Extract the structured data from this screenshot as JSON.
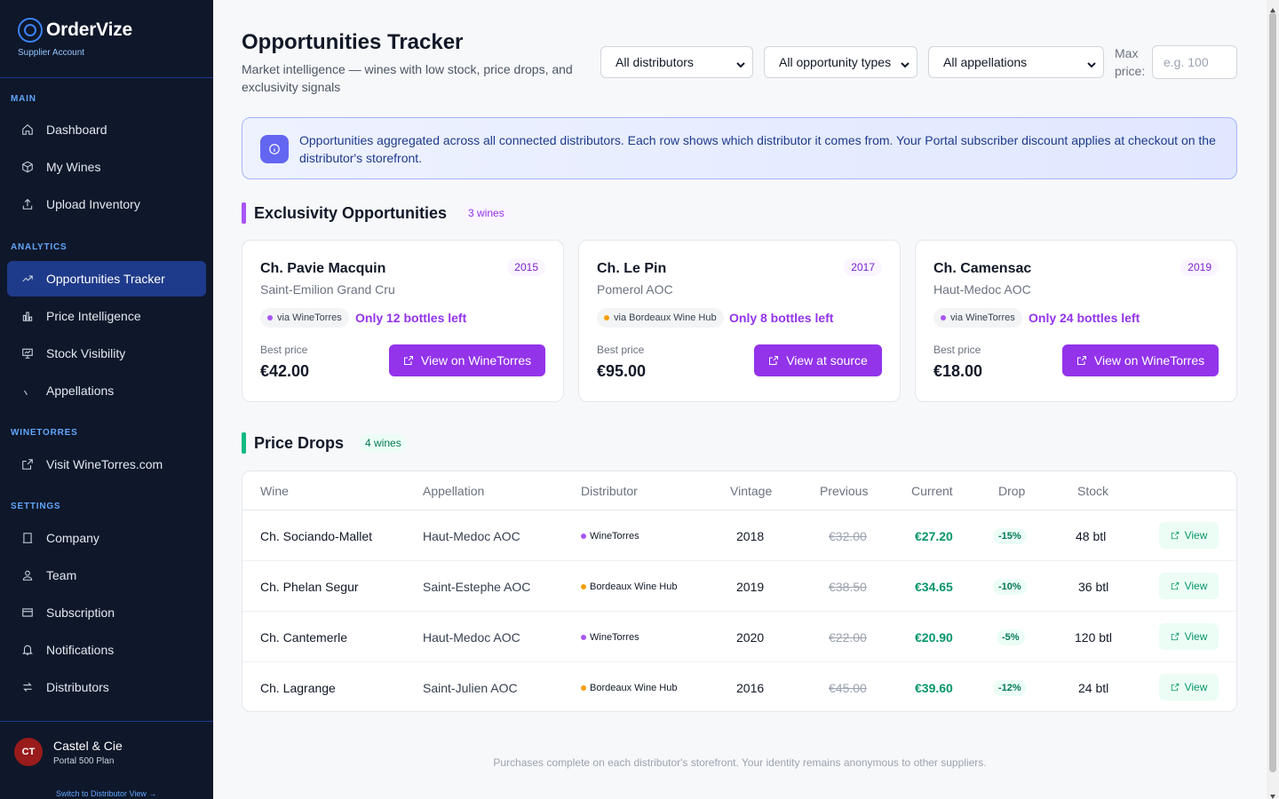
{
  "brand": {
    "name": "OrderVize",
    "subtitle": "Supplier Account"
  },
  "sidebar": {
    "sections": {
      "main": "MAIN",
      "analytics": "ANALYTICS",
      "winetorres": "WINETORRES",
      "settings": "SETTINGS"
    },
    "items": [
      {
        "label": "Dashboard",
        "icon": "home-icon"
      },
      {
        "label": "My Wines",
        "icon": "box-icon"
      },
      {
        "label": "Upload Inventory",
        "icon": "upload-icon"
      },
      {
        "label": "Opportunities Tracker",
        "icon": "trending-up-icon",
        "active": true
      },
      {
        "label": "Price Intelligence",
        "icon": "bar-chart-icon"
      },
      {
        "label": "Stock Visibility",
        "icon": "monitor-icon"
      },
      {
        "label": "Appellations",
        "icon": "map-pin-icon"
      },
      {
        "label": "Visit WineTorres.com",
        "icon": "external-link-icon"
      },
      {
        "label": "Company",
        "icon": "building-icon"
      },
      {
        "label": "Team",
        "icon": "users-icon"
      },
      {
        "label": "Subscription",
        "icon": "credit-card-icon"
      },
      {
        "label": "Notifications",
        "icon": "bell-icon"
      },
      {
        "label": "Distributors",
        "icon": "swap-icon"
      }
    ],
    "user": {
      "initials": "CT",
      "name": "Castel & Cie",
      "plan": "Portal 500 Plan",
      "switch_label": "Switch to Distributor View →"
    }
  },
  "header": {
    "title": "Opportunities Tracker",
    "description": "Market intelligence — wines with low stock, price drops, and exclusivity signals"
  },
  "filters": {
    "distributor": "All distributors",
    "type": "All opportunity types",
    "appellation": "All appellations",
    "max_price_label": "Max price:",
    "max_price_placeholder": "e.g. 100"
  },
  "info": {
    "text": "Opportunities aggregated across all connected distributors. Each row shows which distributor it comes from. Your Portal subscriber discount applies at checkout on the distributor's storefront."
  },
  "exclusivity": {
    "title": "Exclusivity Opportunities",
    "count": "3 wines",
    "accent": "#a855f7",
    "cards": [
      {
        "name": "Ch. Pavie Macquin",
        "vintage": "2015",
        "appellation": "Saint-Emilion Grand Cru",
        "via": "via WineTorres",
        "via_color": "#a855f7",
        "stock": "Only 12 bottles left",
        "best_label": "Best price",
        "price": "€42.00",
        "button": "View on WineTorres"
      },
      {
        "name": "Ch. Le Pin",
        "vintage": "2017",
        "appellation": "Pomerol AOC",
        "via": "via Bordeaux Wine Hub",
        "via_color": "#f59e0b",
        "stock": "Only 8 bottles left",
        "best_label": "Best price",
        "price": "€95.00",
        "button": "View at source"
      },
      {
        "name": "Ch. Camensac",
        "vintage": "2019",
        "appellation": "Haut-Medoc AOC",
        "via": "via WineTorres",
        "via_color": "#a855f7",
        "stock": "Only 24 bottles left",
        "best_label": "Best price",
        "price": "€18.00",
        "button": "View on WineTorres"
      }
    ]
  },
  "price_drops": {
    "title": "Price Drops",
    "count": "4 wines",
    "accent": "#10b981",
    "columns": [
      "Wine",
      "Appellation",
      "Distributor",
      "Vintage",
      "Previous",
      "Current",
      "Drop",
      "Stock"
    ],
    "rows": [
      {
        "wine": "Ch. Sociando-Mallet",
        "appellation": "Haut-Medoc AOC",
        "distributor": "WineTorres",
        "dist_color": "#a855f7",
        "vintage": "2018",
        "previous": "€32.00",
        "current": "€27.20",
        "drop": "-15%",
        "stock": "48 btl",
        "action": "View"
      },
      {
        "wine": "Ch. Phelan Segur",
        "appellation": "Saint-Estephe AOC",
        "distributor": "Bordeaux Wine Hub",
        "dist_color": "#f59e0b",
        "vintage": "2019",
        "previous": "€38.50",
        "current": "€34.65",
        "drop": "-10%",
        "stock": "36 btl",
        "action": "View"
      },
      {
        "wine": "Ch. Cantemerle",
        "appellation": "Haut-Medoc AOC",
        "distributor": "WineTorres",
        "dist_color": "#a855f7",
        "vintage": "2020",
        "previous": "€22.00",
        "current": "€20.90",
        "drop": "-5%",
        "stock": "120 btl",
        "action": "View"
      },
      {
        "wine": "Ch. Lagrange",
        "appellation": "Saint-Julien AOC",
        "distributor": "Bordeaux Wine Hub",
        "dist_color": "#f59e0b",
        "vintage": "2016",
        "previous": "€45.00",
        "current": "€39.60",
        "drop": "-12%",
        "stock": "24 btl",
        "action": "View"
      }
    ]
  },
  "footer": {
    "note": "Purchases complete on each distributor's storefront. Your identity remains anonymous to other suppliers."
  }
}
